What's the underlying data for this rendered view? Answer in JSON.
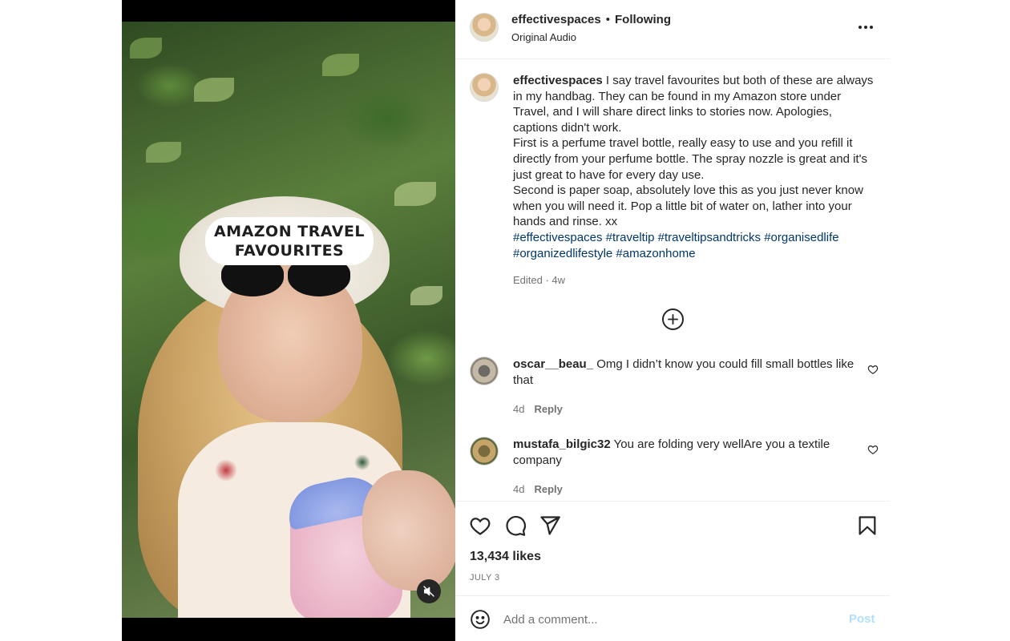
{
  "video": {
    "overlay_title": "AMAZON TRAVEL FAVOURITES",
    "mute_icon": "muted-speaker-icon"
  },
  "header": {
    "username": "effectivespaces",
    "separator": "•",
    "follow_status": "Following",
    "audio": "Original Audio",
    "more_icon": "more-horizontal-icon"
  },
  "caption": {
    "username": "effectivespaces",
    "paragraphs": [
      "I say travel favourites but both of these are always in my handbag. They can be found in my Amazon store under Travel, and I will share direct links to stories now. Apologies, captions didn't work.",
      "First is a perfume travel bottle, really easy to use and you refill it directly from your perfume bottle. The spray nozzle is great and it's just great to have for every day use.",
      "Second is paper soap, absolutely love this as you just never know when you will need it. Pop a little bit of water on, lather into your hands and rinse. xx"
    ],
    "hashtags": "#effectivespaces #traveltip #traveltipsandtricks #organisedlife #organizedlifestyle #amazonhome",
    "meta": "Edited · 4w"
  },
  "load_more_icon": "plus-circle-icon",
  "comments": [
    {
      "username": "oscar__beau_",
      "text": "Omg I didn’t know you could fill small bottles like that",
      "age": "4d",
      "reply": "Reply"
    },
    {
      "username": "mustafa_bilgic32",
      "text": "You are folding very wellAre you a textile company",
      "age": "4d",
      "reply": "Reply"
    }
  ],
  "actions": {
    "like_icon": "heart-icon",
    "comment_icon": "comment-bubble-icon",
    "share_icon": "paper-plane-icon",
    "save_icon": "bookmark-icon",
    "likes": "13,434 likes",
    "date": "JULY 3"
  },
  "add_comment": {
    "emoji_icon": "emoji-smile-icon",
    "placeholder": "Add a comment...",
    "post_label": "Post"
  },
  "colors": {
    "text": "#262626",
    "muted": "#737373",
    "hashtag": "#00376b",
    "post_disabled": "#b2dffc",
    "divider": "#efefef"
  }
}
